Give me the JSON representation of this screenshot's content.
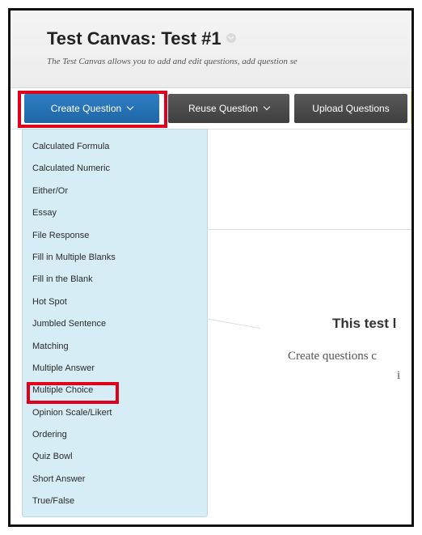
{
  "header": {
    "title": "Test Canvas: Test #1",
    "subtitle": "The Test Canvas allows you to add and edit questions, add question se"
  },
  "toolbar": {
    "create_label": "Create Question",
    "reuse_label": "Reuse Question",
    "upload_label": "Upload Questions"
  },
  "menu": {
    "items": [
      "Calculated Formula",
      "Calculated Numeric",
      "Either/Or",
      "Essay",
      "File Response",
      "Fill in Multiple Blanks",
      "Fill in the Blank",
      "Hot Spot",
      "Jumbled Sentence",
      "Matching",
      "Multiple Answer",
      "Multiple Choice",
      "Opinion Scale/Likert",
      "Ordering",
      "Quiz Bowl",
      "Short Answer",
      "True/False"
    ]
  },
  "empty_state": {
    "title": "This test l",
    "text": "Create questions c",
    "text2": "i"
  },
  "colors": {
    "highlight": "#e0001b",
    "primary_button": "#2f7fc4",
    "menu_background": "#d6edf5"
  }
}
